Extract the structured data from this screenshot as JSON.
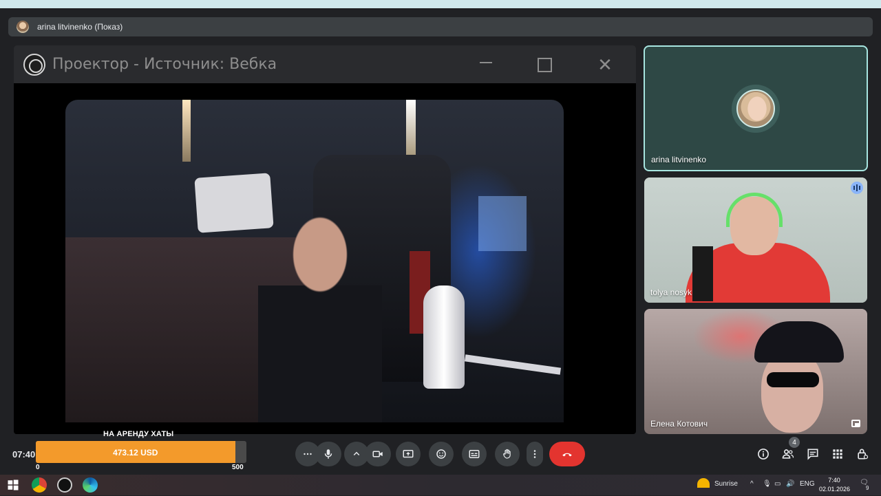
{
  "presentation_bar": {
    "title": "arina litvinenko (Показ)"
  },
  "obs_window": {
    "title": "Проектор - Источник: Вебка"
  },
  "participants": [
    {
      "name": "arina litvinenko"
    },
    {
      "name": "tolya nosyk"
    },
    {
      "name": "Елена Котович"
    }
  ],
  "meeting_clock": "07:40",
  "donation_goal": {
    "label": "НА АРЕНДУ ХАТЫ",
    "amount": "473.12 USD",
    "current": 473.12,
    "min_label": "0",
    "max_label": "500",
    "max": 500,
    "fill_color": "#f39a2b"
  },
  "controls": {
    "more": "more-options-icon",
    "mic": "mic-icon",
    "camera": "camera-icon",
    "present": "present-screen-icon",
    "reactions": "emoji-icon",
    "captions": "captions-icon",
    "raise_hand": "hand-icon",
    "leave": "hang-up-icon",
    "leave_color": "#e3342f"
  },
  "people_count": "4",
  "taskbar": {
    "weather_label": "Sunrise",
    "language": "ENG",
    "time": "7:40",
    "date": "02.01.2026",
    "notifications": "9"
  }
}
